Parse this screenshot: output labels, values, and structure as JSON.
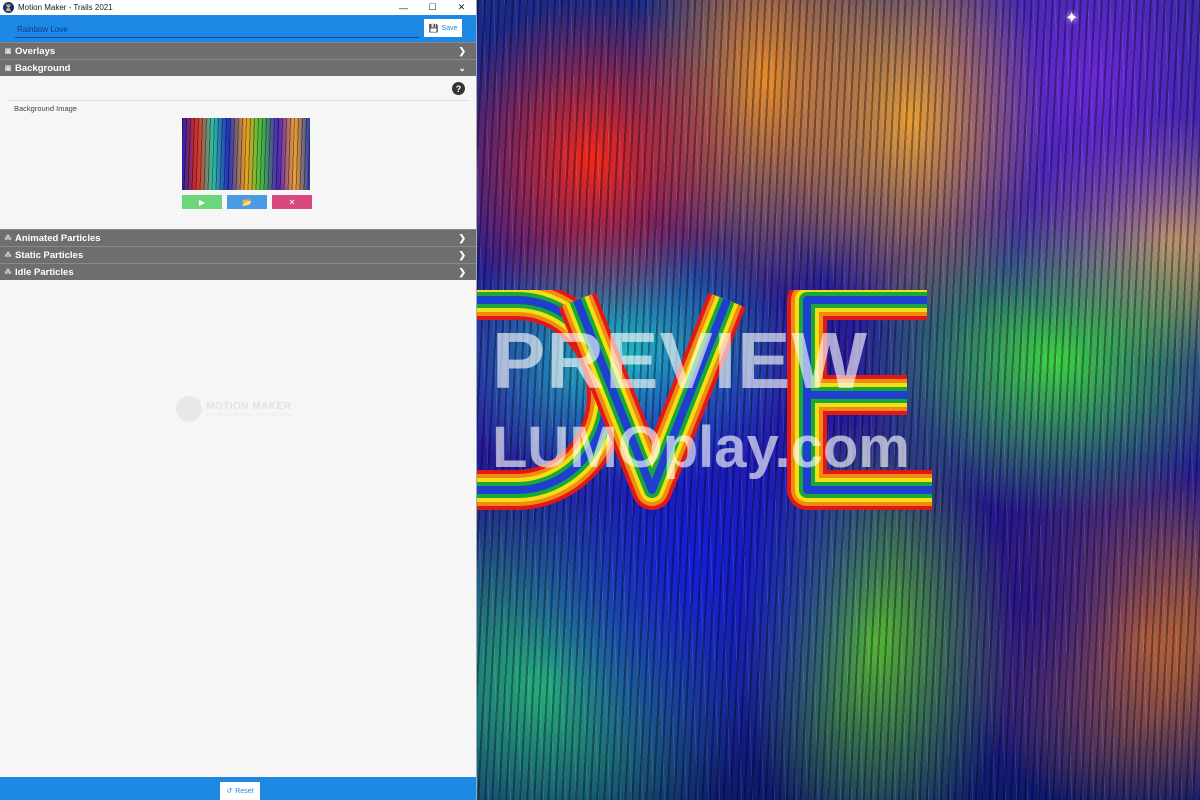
{
  "window": {
    "title": "Motion Maker - Trails 2021",
    "app_icon_glyph": "⏳",
    "minimize_glyph": "—",
    "maximize_glyph": "☐",
    "close_glyph": "✕"
  },
  "header": {
    "name_value": "Rainbow Love",
    "save_label": "Save",
    "accent_color": "#1e88e5"
  },
  "sections": {
    "overlays": {
      "label": "Overlays",
      "icon": "image-icon",
      "expanded": false
    },
    "background": {
      "label": "Background",
      "icon": "image-icon",
      "expanded": true
    },
    "animated": {
      "label": "Animated Particles",
      "icon": "particles-icon",
      "expanded": false
    },
    "static": {
      "label": "Static Particles",
      "icon": "particles-icon",
      "expanded": false
    },
    "idle": {
      "label": "Idle Particles",
      "icon": "particles-icon",
      "expanded": false
    }
  },
  "background_panel": {
    "image_label": "Background Image",
    "help_glyph": "?",
    "buttons": {
      "play_glyph": "▶",
      "folder_glyph": "📂",
      "remove_glyph": "✕"
    }
  },
  "watermark": {
    "logo_title": "MOTION MAKER",
    "logo_subtitle": "MOTION BACKGROUND CREATION SYSTEM"
  },
  "footer": {
    "reset_label": "Reset"
  },
  "preview": {
    "overlay_text": "PREVIEW",
    "site_text": "LUMOplay.com",
    "art_text": "LOVE"
  }
}
